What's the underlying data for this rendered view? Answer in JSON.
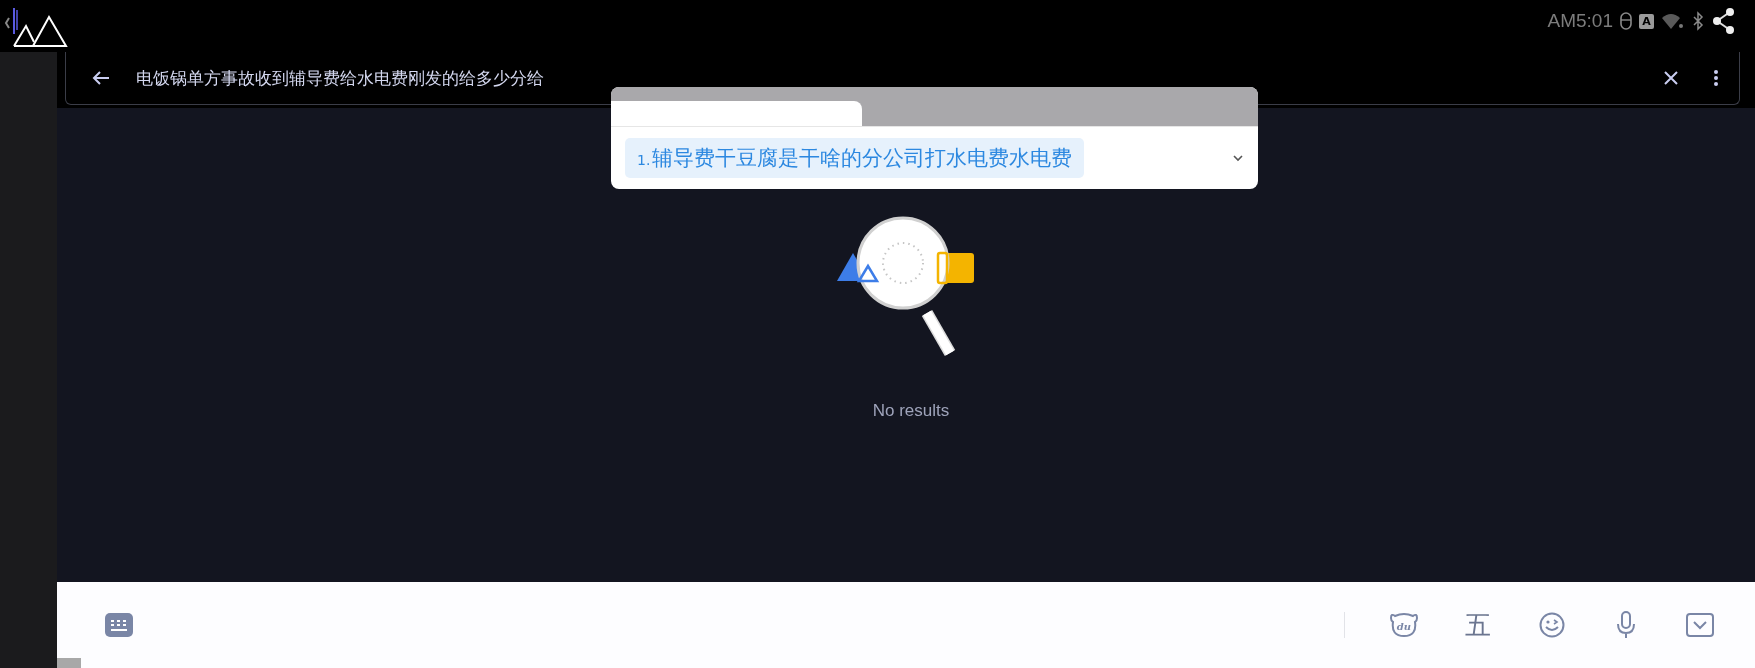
{
  "status_bar": {
    "time": "AM5:01",
    "input_badge": "A"
  },
  "search": {
    "value": "电饭锅单方事故收到辅导费给水电费刚发的给多少分给"
  },
  "candidate_popup": {
    "candidates": [
      {
        "index": "1.",
        "text": "辅导费干豆腐是干啥的分公司打水电费水电费",
        "selected": true
      }
    ]
  },
  "empty_state": {
    "message": "No results"
  },
  "keyboard_toolbar": {
    "bear_label": "du",
    "wubi_key": "五"
  }
}
